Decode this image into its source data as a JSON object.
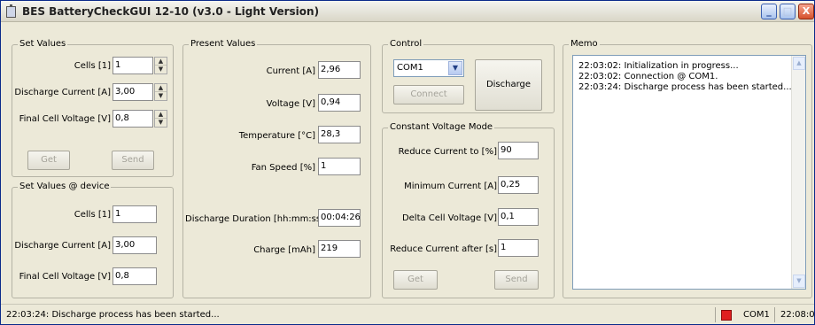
{
  "window": {
    "title": "BES BatteryCheckGUI 12-10 (v3.0 - Light Version)",
    "controls": [
      "_",
      "□",
      "X"
    ]
  },
  "set_values": {
    "title": "Set Values",
    "cells_label": "Cells [1]",
    "cells_value": "1",
    "discharge_current_label": "Discharge Current [A]",
    "discharge_current_value": "3,00",
    "final_voltage_label": "Final Cell Voltage [V]",
    "final_voltage_value": "0,8",
    "get_label": "Get",
    "send_label": "Send"
  },
  "device_values": {
    "title": "Set Values @ device",
    "cells_label": "Cells [1]",
    "cells_value": "1",
    "discharge_current_label": "Discharge Current [A]",
    "discharge_current_value": "3,00",
    "final_voltage_label": "Final Cell Voltage [V]",
    "final_voltage_value": "0,8"
  },
  "present_values": {
    "title": "Present Values",
    "current_label": "Current [A]",
    "current_value": "2,96",
    "voltage_label": "Voltage [V]",
    "voltage_value": "0,94",
    "temperature_label": "Temperature [°C]",
    "temperature_value": "28,3",
    "fan_label": "Fan Speed [%]",
    "fan_value": "1",
    "duration_label": "Discharge Duration [hh:mm:ss]",
    "duration_value": "00:04:26",
    "charge_label": "Charge [mAh]",
    "charge_value": "219"
  },
  "control": {
    "title": "Control",
    "port_selected": "COM1",
    "connect_label": "Connect",
    "discharge_label": "Discharge"
  },
  "cv_mode": {
    "title": "Constant Voltage Mode",
    "reduce_to_label": "Reduce Current to [%]",
    "reduce_to_value": "90",
    "min_current_label": "Minimum Current [A]",
    "min_current_value": "0,25",
    "delta_label": "Delta Cell Voltage [V]",
    "delta_value": "0,1",
    "reduce_after_label": "Reduce Current after [s]",
    "reduce_after_value": "1",
    "get_label": "Get",
    "send_label": "Send"
  },
  "memo": {
    "title": "Memo",
    "lines": [
      "22:03:02: Initialization in progress...",
      "22:03:02: Connection @ COM1.",
      "22:03:24: Discharge process has been started..."
    ]
  },
  "status": {
    "message": "22:03:24: Discharge process has been started...",
    "port": "COM1",
    "time": "22:08:0",
    "led_color": "#e02020"
  }
}
